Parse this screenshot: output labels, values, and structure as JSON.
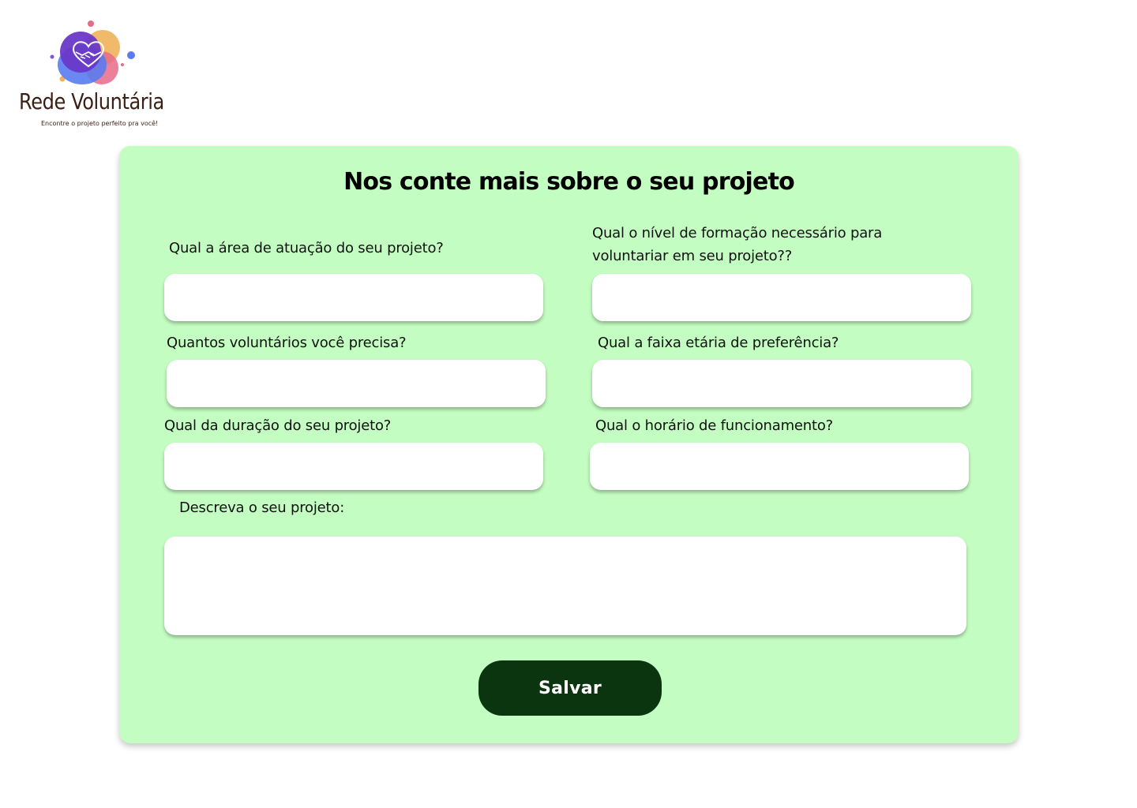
{
  "brand": {
    "name": "Rede Voluntária",
    "tagline": "Encontre o projeto perfeito pra você!",
    "logo_icon": "handshake-heart-icon",
    "colors": {
      "purple": "#6a38c8",
      "blue": "#5a7bf0",
      "orange": "#f0b35a",
      "pink": "#e86a8a",
      "text": "#3a1f14"
    }
  },
  "form": {
    "title": "Nos conte mais sobre o seu projeto",
    "background": "#c4fdc2",
    "fields": {
      "area": {
        "label": "Qual a área de atuação do seu projeto?",
        "value": "",
        "placeholder": ""
      },
      "formacao": {
        "label_line1": "Qual o nível de formação necessário para",
        "label_line2": "voluntariar em seu projeto??",
        "value": "",
        "placeholder": ""
      },
      "voluntarios": {
        "label": "Quantos voluntários você precisa?",
        "value": "",
        "placeholder": ""
      },
      "faixa_etaria": {
        "label": "Qual a faixa etária de preferência?",
        "value": "",
        "placeholder": ""
      },
      "duracao": {
        "label": "Qual da duração do seu projeto?",
        "value": "",
        "placeholder": ""
      },
      "horario": {
        "label": "Qual o horário de funcionamento?",
        "value": "",
        "placeholder": ""
      },
      "descricao": {
        "label": "Descreva o seu projeto:",
        "value": "",
        "placeholder": ""
      }
    },
    "save_label": "Salvar",
    "save_color": "#0b350e"
  }
}
